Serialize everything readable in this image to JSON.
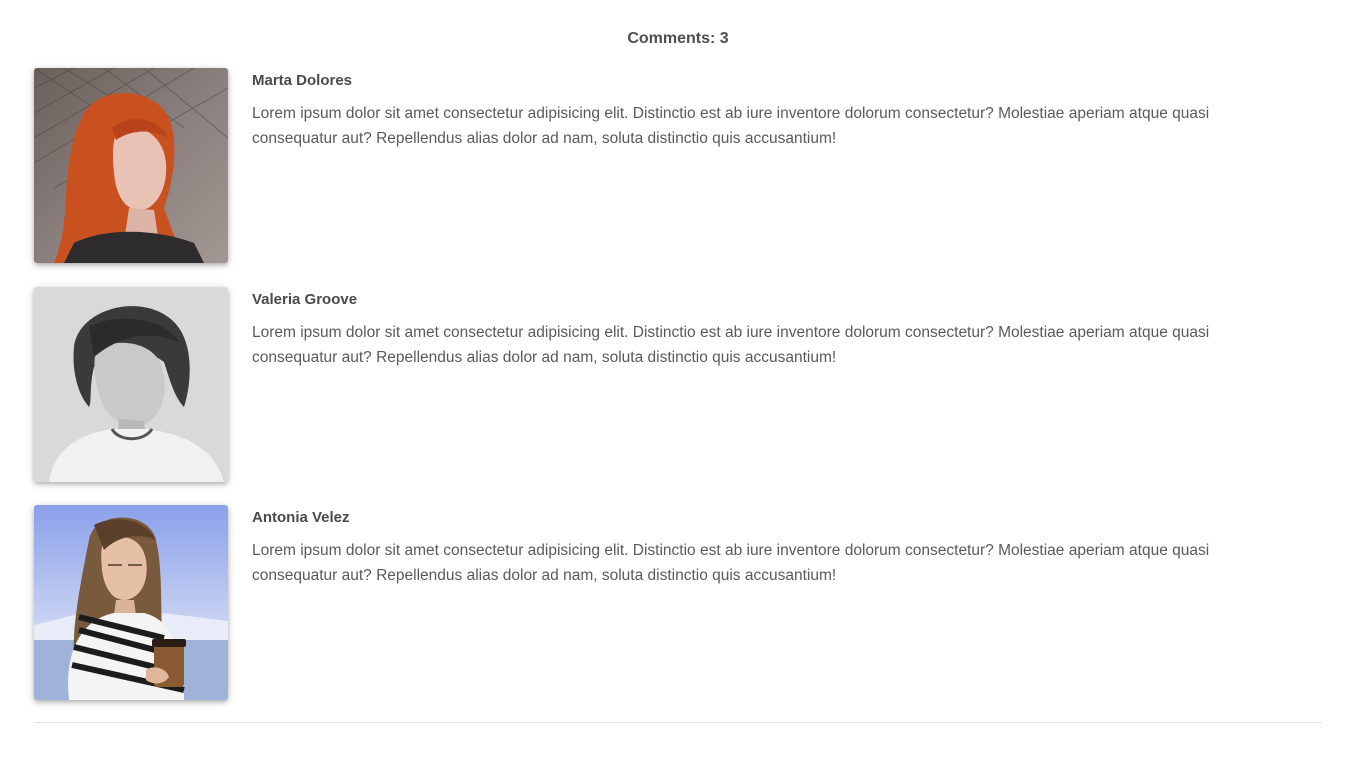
{
  "header": {
    "comments_count_label": "Comments: 3"
  },
  "comments": [
    {
      "author": "Marta Dolores",
      "text": "Lorem ipsum dolor sit amet consectetur adipisicing elit. Distinctio est ab iure inventore dolorum consectetur? Molestiae aperiam atque quasi consequatur aut? Repellendus alias dolor ad nam, soluta distinctio quis accusantium!"
    },
    {
      "author": "Valeria Groove",
      "text": "Lorem ipsum dolor sit amet consectetur adipisicing elit. Distinctio est ab iure inventore dolorum consectetur? Molestiae aperiam atque quasi consequatur aut? Repellendus alias dolor ad nam, soluta distinctio quis accusantium!"
    },
    {
      "author": "Antonia Velez",
      "text": "Lorem ipsum dolor sit amet consectetur adipisicing elit. Distinctio est ab iure inventore dolorum consectetur? Molestiae aperiam atque quasi consequatur aut? Repellendus alias dolor ad nam, soluta distinctio quis accusantium!"
    }
  ],
  "colors": {
    "text_primary": "#4a4a4a",
    "text_body": "#5a5a5a",
    "divider": "#e2e2e2"
  }
}
